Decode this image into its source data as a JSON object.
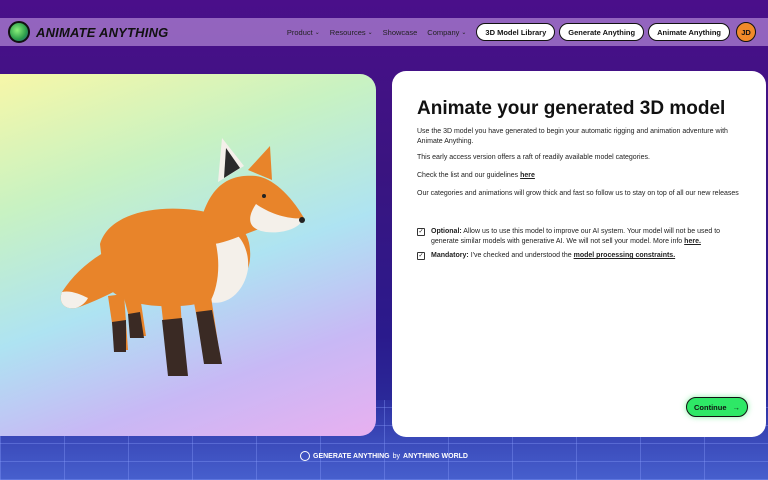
{
  "brand": {
    "name": "ANIMATE ANYTHING",
    "logo_icon": "globe-logo-icon"
  },
  "nav": {
    "links": [
      {
        "label": "Product",
        "has_menu": true
      },
      {
        "label": "Resources",
        "has_menu": true
      },
      {
        "label": "Showcase",
        "has_menu": false
      },
      {
        "label": "Company",
        "has_menu": true
      }
    ],
    "buttons": [
      "3D Model Library",
      "Generate Anything",
      "Animate Anything"
    ],
    "avatar_initials": "JD"
  },
  "info": {
    "title": "Animate your generated 3D model",
    "para1": "Use the 3D model you have generated to begin your automatic rigging and animation adventure with Animate Anything.",
    "para2": "This early access version offers a raft of readily available model categories.",
    "para3_prefix": "Check the list and our guidelines",
    "para3_link": "here",
    "para4": "Our categories and animations will grow thick and fast so follow us to stay on top of all our new releases",
    "optional_label": "Optional:",
    "optional_text": "Allow us to use this model to improve our AI system. Your model will not be used to generate similar models with generative AI. We will not sell your model. More info",
    "optional_link": "here.",
    "mandatory_label": "Mandatory:",
    "mandatory_text": "I've checked and understood the",
    "mandatory_link": "model processing constraints.",
    "optional_checked": true,
    "mandatory_checked": true,
    "continue_label": "Continue"
  },
  "footer": {
    "brand": "GENERATE ANYTHING",
    "by": "by",
    "company": "ANYTHING WORLD"
  },
  "colors": {
    "accent": "#2ee866",
    "background": "#3a1480"
  }
}
